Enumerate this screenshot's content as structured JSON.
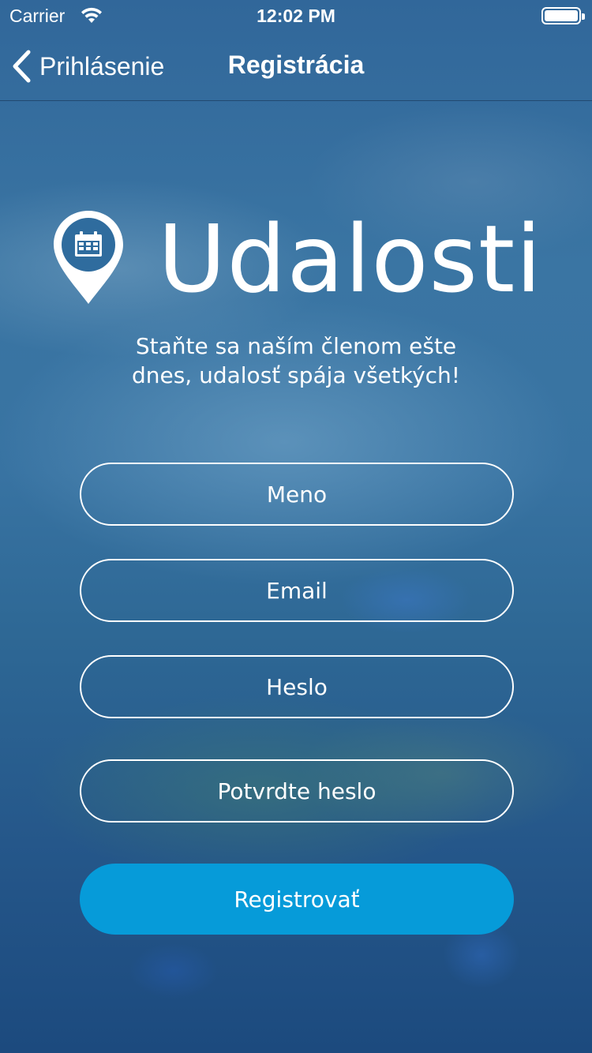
{
  "status_bar": {
    "carrier": "Carrier",
    "time": "12:02 PM",
    "wifi_icon": "wifi-icon",
    "battery_icon": "battery-icon"
  },
  "nav": {
    "back_label": "Prihlásenie",
    "back_icon": "chevron-left-icon",
    "title": "Registrácia"
  },
  "logo": {
    "icon": "map-pin-calendar-icon",
    "name": "Udalosti"
  },
  "tagline": {
    "line1": "Staňte sa naším členom ešte",
    "line2": "dnes, udalosť spája všetkých!"
  },
  "form": {
    "name_placeholder": "Meno",
    "email_placeholder": "Email",
    "password_placeholder": "Heslo",
    "confirm_placeholder": "Potvrdte heslo",
    "submit_label": "Registrovať"
  },
  "colors": {
    "accent": "#069bd9",
    "text": "#ffffff",
    "background": "#2e6895"
  }
}
